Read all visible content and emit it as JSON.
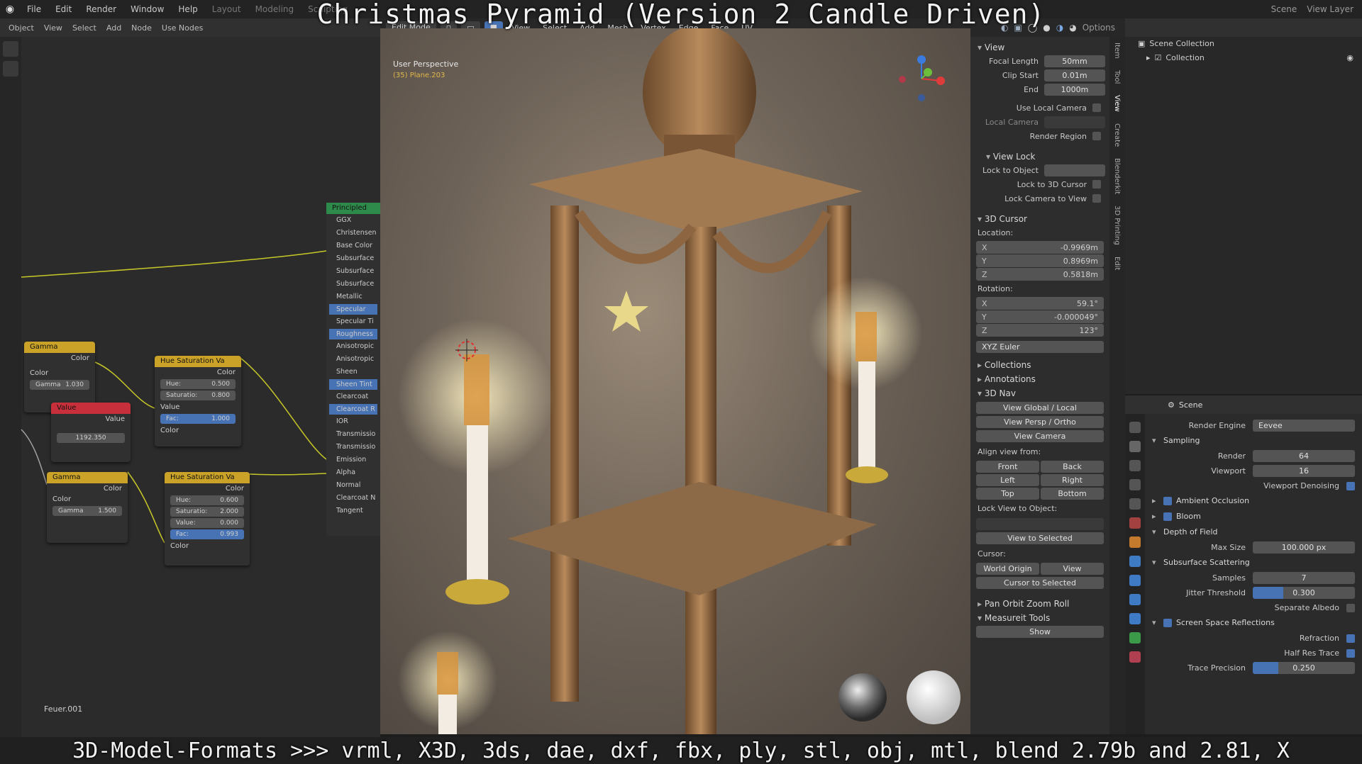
{
  "overlay": {
    "title": "Christmas Pyramid (Version 2 Candle Driven)",
    "bottom_caption": "3D-Model-Formats >>> vrml, X3D, 3ds, dae, dxf, fbx, ply, stl, obj, mtl, blend 2.79b and 2.81, X"
  },
  "topbar": {
    "menu": [
      "File",
      "Edit",
      "Render",
      "Window",
      "Help"
    ],
    "workspaces": [
      "Layout",
      "Modeling",
      "Sculpting"
    ],
    "scene": "Scene",
    "view_layer": "View Layer"
  },
  "node_editor": {
    "header": [
      "Object",
      "View",
      "Select",
      "Add",
      "Node",
      "Use Nodes"
    ],
    "principled": {
      "title": "Principled",
      "rows": [
        "GGX",
        "Christensen",
        "Base Color",
        "Subsurface",
        "Subsurface",
        "Subsurface",
        "Metallic",
        "Specular",
        "Specular Ti",
        "Roughness",
        "Anisotropic",
        "Anisotropic",
        "Sheen",
        "Sheen Tint",
        "Clearcoat",
        "Clearcoat R",
        "IOR",
        "Transmissio",
        "Transmissio",
        "Emission",
        "Alpha",
        "Normal",
        "Clearcoat N",
        "Tangent"
      ],
      "highlighted": [
        7,
        9,
        13,
        15
      ]
    },
    "gamma1": {
      "title": "Gamma",
      "out": "Color",
      "in": "Color",
      "field_label": "Gamma",
      "field_value": "1.030"
    },
    "value": {
      "title": "Value",
      "out": "Value",
      "field_value": "1192.350"
    },
    "gamma2": {
      "title": "Gamma",
      "out": "Color",
      "in": "Color",
      "field_label": "Gamma",
      "field_value": "1.500"
    },
    "hsv1": {
      "title": "Hue Saturation Va",
      "out": "Color",
      "hue": "0.500",
      "sat": "0.800",
      "value_label": "Value",
      "fac": "1.000",
      "color": "Color"
    },
    "hsv2": {
      "title": "Hue Saturation Va",
      "out": "Color",
      "hue": "0.600",
      "sat": "2.000",
      "value": "0.000",
      "fac": "0.993",
      "color": "Color"
    },
    "object_label": "Feuer.001"
  },
  "viewport": {
    "mode": "Edit Mode",
    "menus": [
      "View",
      "Select",
      "Add",
      "Mesh",
      "Vertex",
      "Edge",
      "Face",
      "UV"
    ],
    "perspective": "User Perspective",
    "object_info": "(35) Plane.203",
    "options": "Options"
  },
  "npanel": {
    "tabs": [
      "Item",
      "Tool",
      "View",
      "Create",
      "Blenderkit",
      "3D Printing",
      "Edit"
    ],
    "view": {
      "title": "View",
      "focal_length_label": "Focal Length",
      "focal_length": "50mm",
      "clip_start_label": "Clip Start",
      "clip_start": "0.01m",
      "end_label": "End",
      "end": "1000m",
      "use_local_camera": "Use Local Camera",
      "local_camera": "Local Camera",
      "render_region": "Render Region"
    },
    "view_lock": {
      "title": "View Lock",
      "lock_to_object": "Lock to Object",
      "lock_to_cursor": "Lock to 3D Cursor",
      "lock_camera": "Lock Camera to View"
    },
    "cursor": {
      "title": "3D Cursor",
      "location_label": "Location:",
      "x": "-0.9969m",
      "y": "0.8969m",
      "z": "0.5818m",
      "rotation_label": "Rotation:",
      "rx": "59.1°",
      "ry": "-0.000049°",
      "rz": "123°",
      "mode": "XYZ Euler"
    },
    "sections": [
      "Collections",
      "Annotations"
    ],
    "nav": {
      "title": "3D Nav",
      "view_global": "View Global / Local",
      "view_persp": "View Persp / Ortho",
      "view_camera": "View Camera",
      "align_from": "Align view from:",
      "front": "Front",
      "back": "Back",
      "left": "Left",
      "right": "Right",
      "top": "Top",
      "bottom": "Bottom",
      "lock_view": "Lock View to Object:",
      "view_selected": "View to Selected",
      "cursor_label": "Cursor:",
      "world_origin": "World Origin",
      "view": "View",
      "cursor_selected": "Cursor to Selected"
    },
    "pan_orbit": "Pan Orbit Zoom Roll",
    "measureit": "Measureit Tools",
    "show": "Show"
  },
  "outliner": {
    "scene_collection": "Scene Collection",
    "collection": "Collection"
  },
  "properties": {
    "header": "Scene",
    "render_engine_label": "Render Engine",
    "render_engine": "Eevee",
    "sampling": "Sampling",
    "render_label": "Render",
    "render": "64",
    "viewport_label": "Viewport",
    "viewport": "16",
    "viewport_denoising": "Viewport Denoising",
    "ambient_occlusion": "Ambient Occlusion",
    "bloom": "Bloom",
    "dof": "Depth of Field",
    "max_size_label": "Max Size",
    "max_size": "100.000 px",
    "sss": "Subsurface Scattering",
    "samples_label": "Samples",
    "samples": "7",
    "jitter_label": "Jitter Threshold",
    "jitter": "0.300",
    "jitter_fill": 0.3,
    "separate_albedo": "Separate Albedo",
    "ssr": "Screen Space Reflections",
    "refraction": "Refraction",
    "half_res": "Half Res Trace",
    "trace_label": "Trace Precision",
    "trace": "0.250",
    "trace_fill": 0.25
  },
  "colors": {
    "accent": "#4772b3",
    "node_gamma": "#c9a227",
    "node_value": "#c7303a",
    "principled": "#2e8a4a"
  }
}
